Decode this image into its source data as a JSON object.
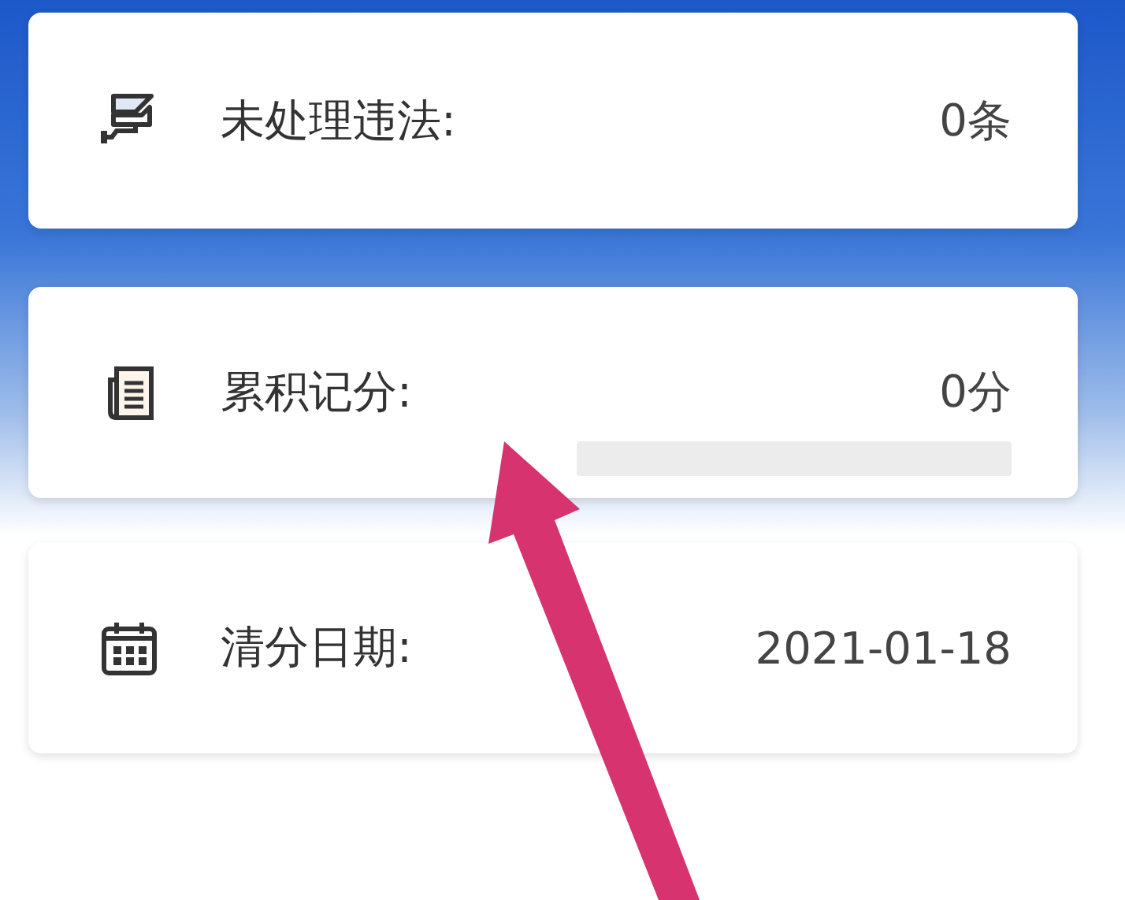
{
  "cards": [
    {
      "kind": "camera",
      "label": "未处理违法:",
      "value": "0条"
    },
    {
      "kind": "document",
      "label": "累积记分:",
      "value": "0分",
      "level": 0
    },
    {
      "kind": "calendar",
      "label": "清分日期:",
      "value": "2021-01-18"
    }
  ]
}
